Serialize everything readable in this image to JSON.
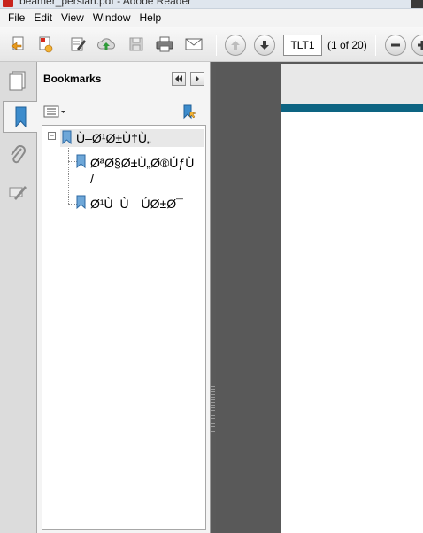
{
  "window": {
    "title": "beamer_persian.pdf - Adobe Reader"
  },
  "menu": {
    "items": [
      "File",
      "Edit",
      "View",
      "Window",
      "Help"
    ]
  },
  "toolbar": {
    "page_value": "TLT1",
    "page_count": "(1 of 20)",
    "icons": [
      "create-icon",
      "convert-icon",
      "sign-icon",
      "upload-icon",
      "save-icon",
      "print-icon",
      "email-icon",
      "previous-page-icon",
      "next-page-icon",
      "zoom-out-icon",
      "zoom-in-icon"
    ]
  },
  "leftstrip": {
    "icons": [
      "pages-icon",
      "bookmarks-icon",
      "attachments-icon",
      "signatures-icon"
    ]
  },
  "bookmarks": {
    "title": "Bookmarks",
    "items": [
      {
        "label": "Ù–Ø¹Ø±Ù†Ù„",
        "level": 0,
        "expanded": true
      },
      {
        "label": "ØªØ§Ø±Ù„Ø®ÚƒÙ",
        "label_line2": "/",
        "level": 1
      },
      {
        "label": "Ø¹Ù–Ù—ÚØ±Ø¯",
        "level": 1
      }
    ]
  },
  "colors": {
    "page_bar": "#0d6482",
    "doc_background": "#595959"
  }
}
